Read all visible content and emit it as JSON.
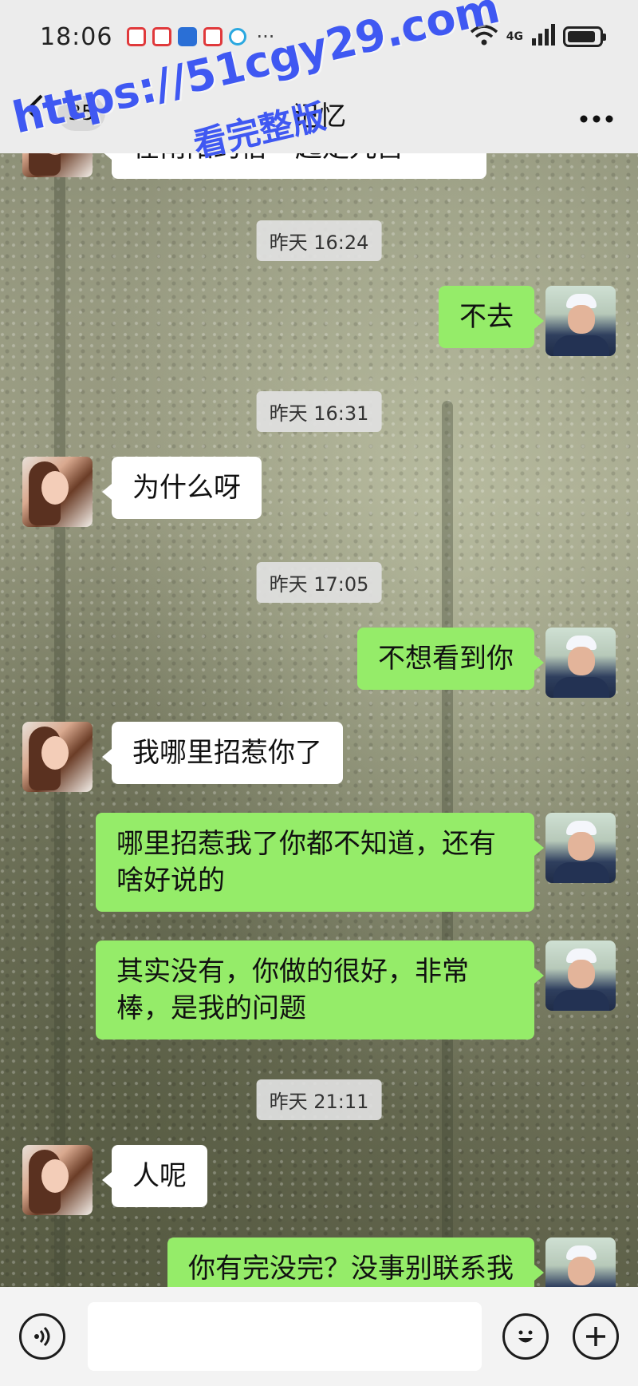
{
  "status_bar": {
    "time": "18:06",
    "notification_icons": [
      "red-square-icon",
      "red-mascot-icon",
      "blue-app-icon",
      "red-square-icon",
      "cyan-circle-icon"
    ],
    "more": "···",
    "network": "4G",
    "wifi_signal": "6",
    "battery_level": 0.9
  },
  "nav": {
    "back_icon": "chevron-left-icon",
    "unread_count": "35",
    "title": "记忆",
    "more_icon": "more-horizontal-icon"
  },
  "watermark": {
    "url": "https://51cgy29.com",
    "subtitle": "看完整版"
  },
  "messages": {
    "partial_top": "在南阳约俗一起走九宫",
    "t1": "昨天 16:24",
    "m1": "不去",
    "t2": "昨天 16:31",
    "m2": "为什么呀",
    "t3": "昨天 17:05",
    "m3": "不想看到你",
    "m4": "我哪里招惹你了",
    "m5": "哪里招惹我了你都不知道，还有啥好说的",
    "m6": "其实没有，你做的很好，非常棒，是我的问题",
    "t4": "昨天 21:11",
    "m7": "人呢",
    "m8": "你有完没完？没事别联系我"
  },
  "input_bar": {
    "voice_icon": "voice-icon",
    "emoji_icon": "emoji-icon",
    "plus_icon": "plus-icon",
    "placeholder": ""
  },
  "colors": {
    "outgoing_bubble": "#95ec69",
    "incoming_bubble": "#ffffff",
    "watermark": "#3f58f2"
  }
}
